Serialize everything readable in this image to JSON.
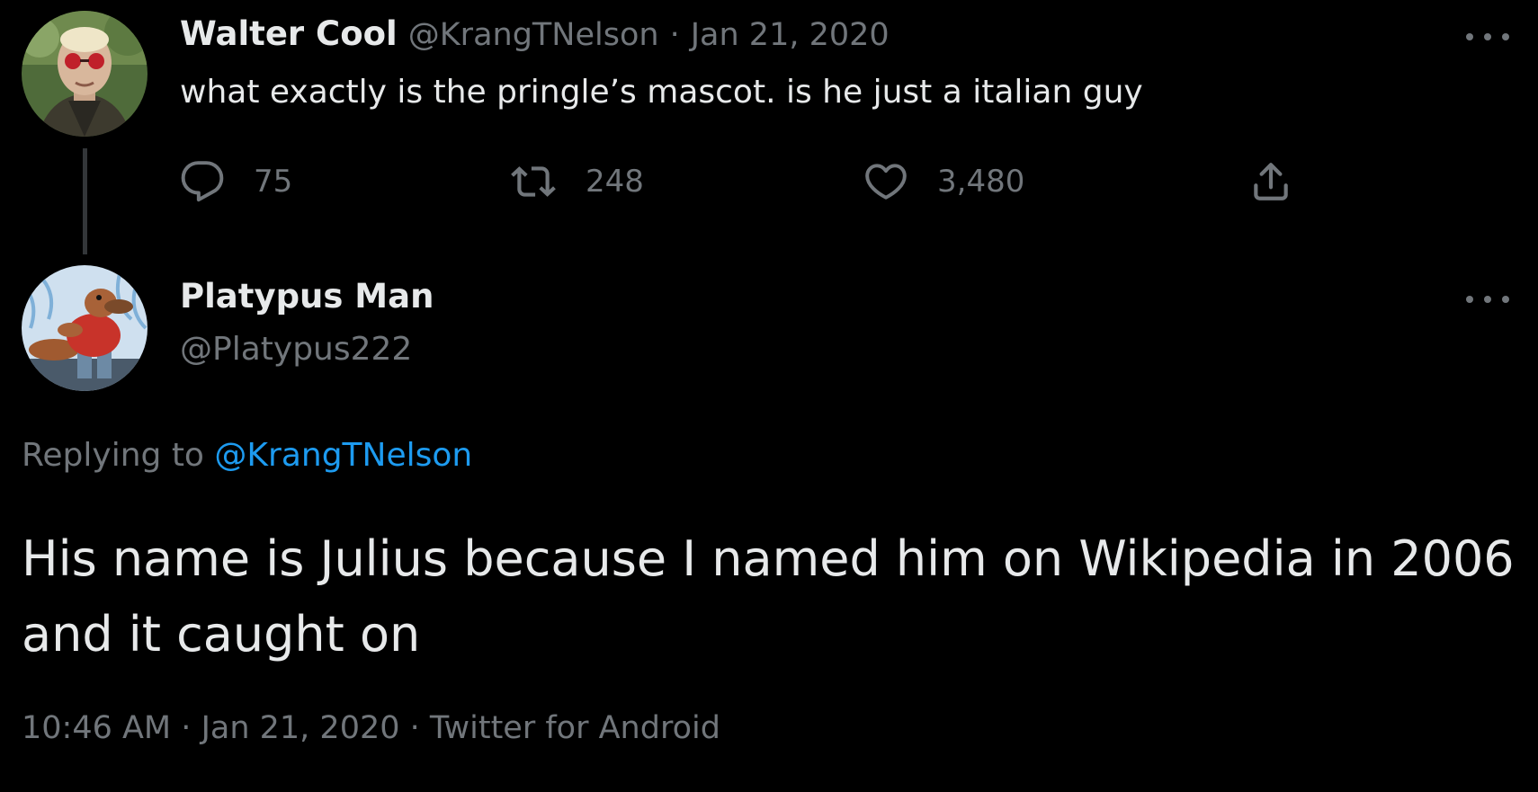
{
  "parent_tweet": {
    "display_name": "Walter Cool",
    "handle": "@KrangTNelson",
    "separator": "·",
    "date": "Jan 21, 2020",
    "text": "what exactly is the pringle’s mascot. is he just a italian guy",
    "actions": {
      "reply_icon": "speech-bubble-icon",
      "reply_count": "75",
      "retweet_icon": "retweet-icon",
      "retweet_count": "248",
      "like_icon": "heart-icon",
      "like_count": "3,480",
      "share_icon": "share-icon"
    },
    "more_icon": "more-dots-icon"
  },
  "reply_tweet": {
    "display_name": "Platypus Man",
    "handle": "@Platypus222",
    "replying_prefix": "Replying to",
    "replying_to": "@KrangTNelson",
    "text": "His name is Julius because I named him on Wikipedia in 2006 and it caught on",
    "time": "10:46 AM",
    "separator": "·",
    "date": "Jan 21, 2020",
    "source": "Twitter for Android",
    "more_icon": "more-dots-icon"
  },
  "colors": {
    "background": "#000000",
    "primary_text": "#e7e9ea",
    "secondary_text": "#71767b",
    "link": "#1d9bf0",
    "thread_line": "#333639"
  }
}
